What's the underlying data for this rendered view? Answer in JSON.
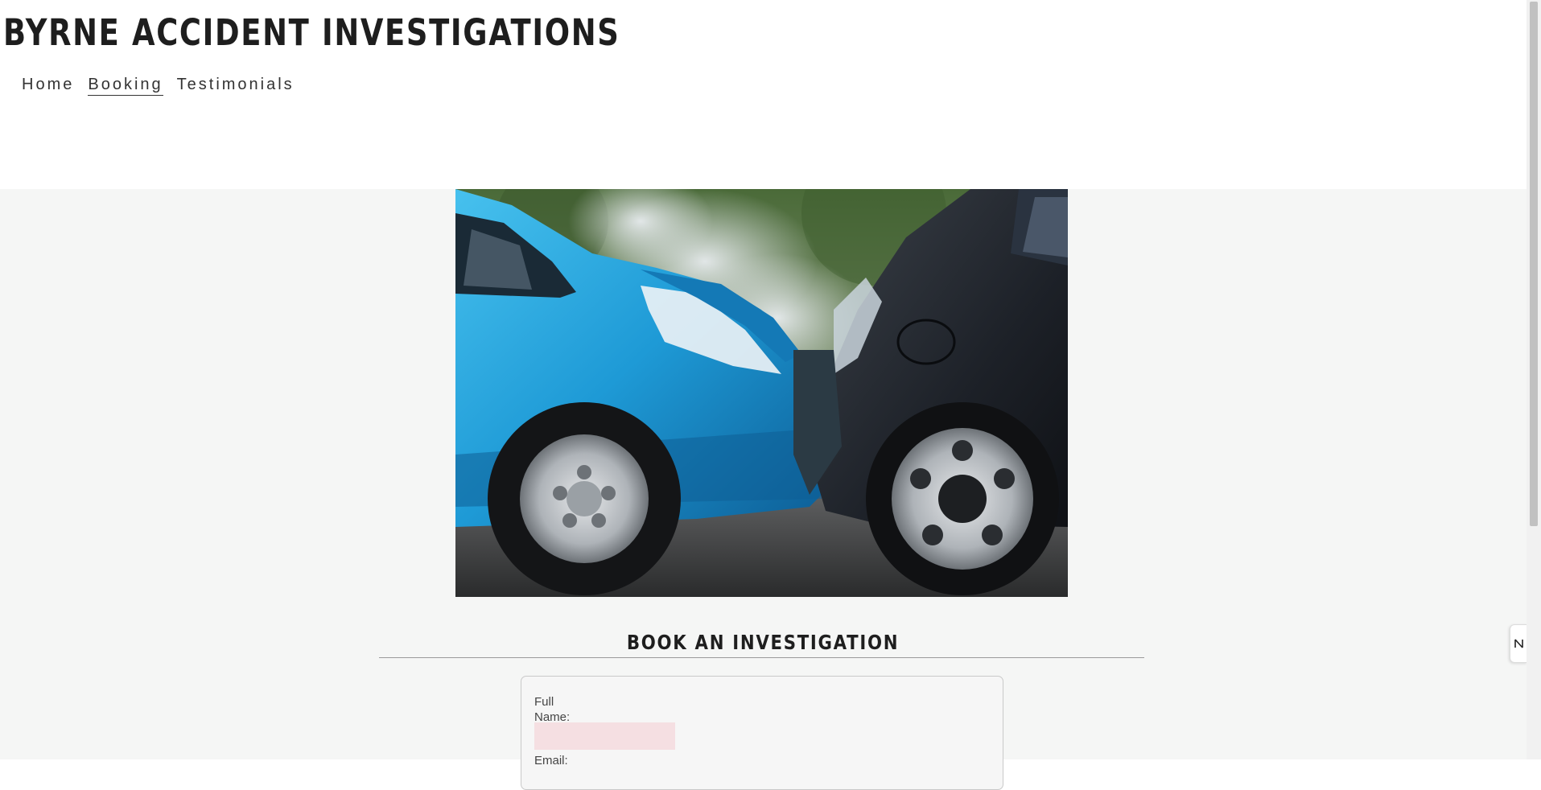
{
  "header": {
    "title": "BYRNE ACCIDENT INVESTIGATIONS",
    "nav": [
      {
        "label": "Home",
        "active": false
      },
      {
        "label": "Booking",
        "active": true
      },
      {
        "label": "Testimonials",
        "active": false
      }
    ]
  },
  "hero": {
    "icon": "car-crash-photo"
  },
  "booking": {
    "title": "BOOK AN INVESTIGATION",
    "full_name_label": "Full Name:",
    "full_name_value": "",
    "email_label": "Email:"
  },
  "colors": {
    "background": "#f5f6f5",
    "input_fill": "#f5dfe2",
    "title_text": "#1e1e1e"
  },
  "side_widget": {
    "icon": "expand-arrows-icon"
  }
}
